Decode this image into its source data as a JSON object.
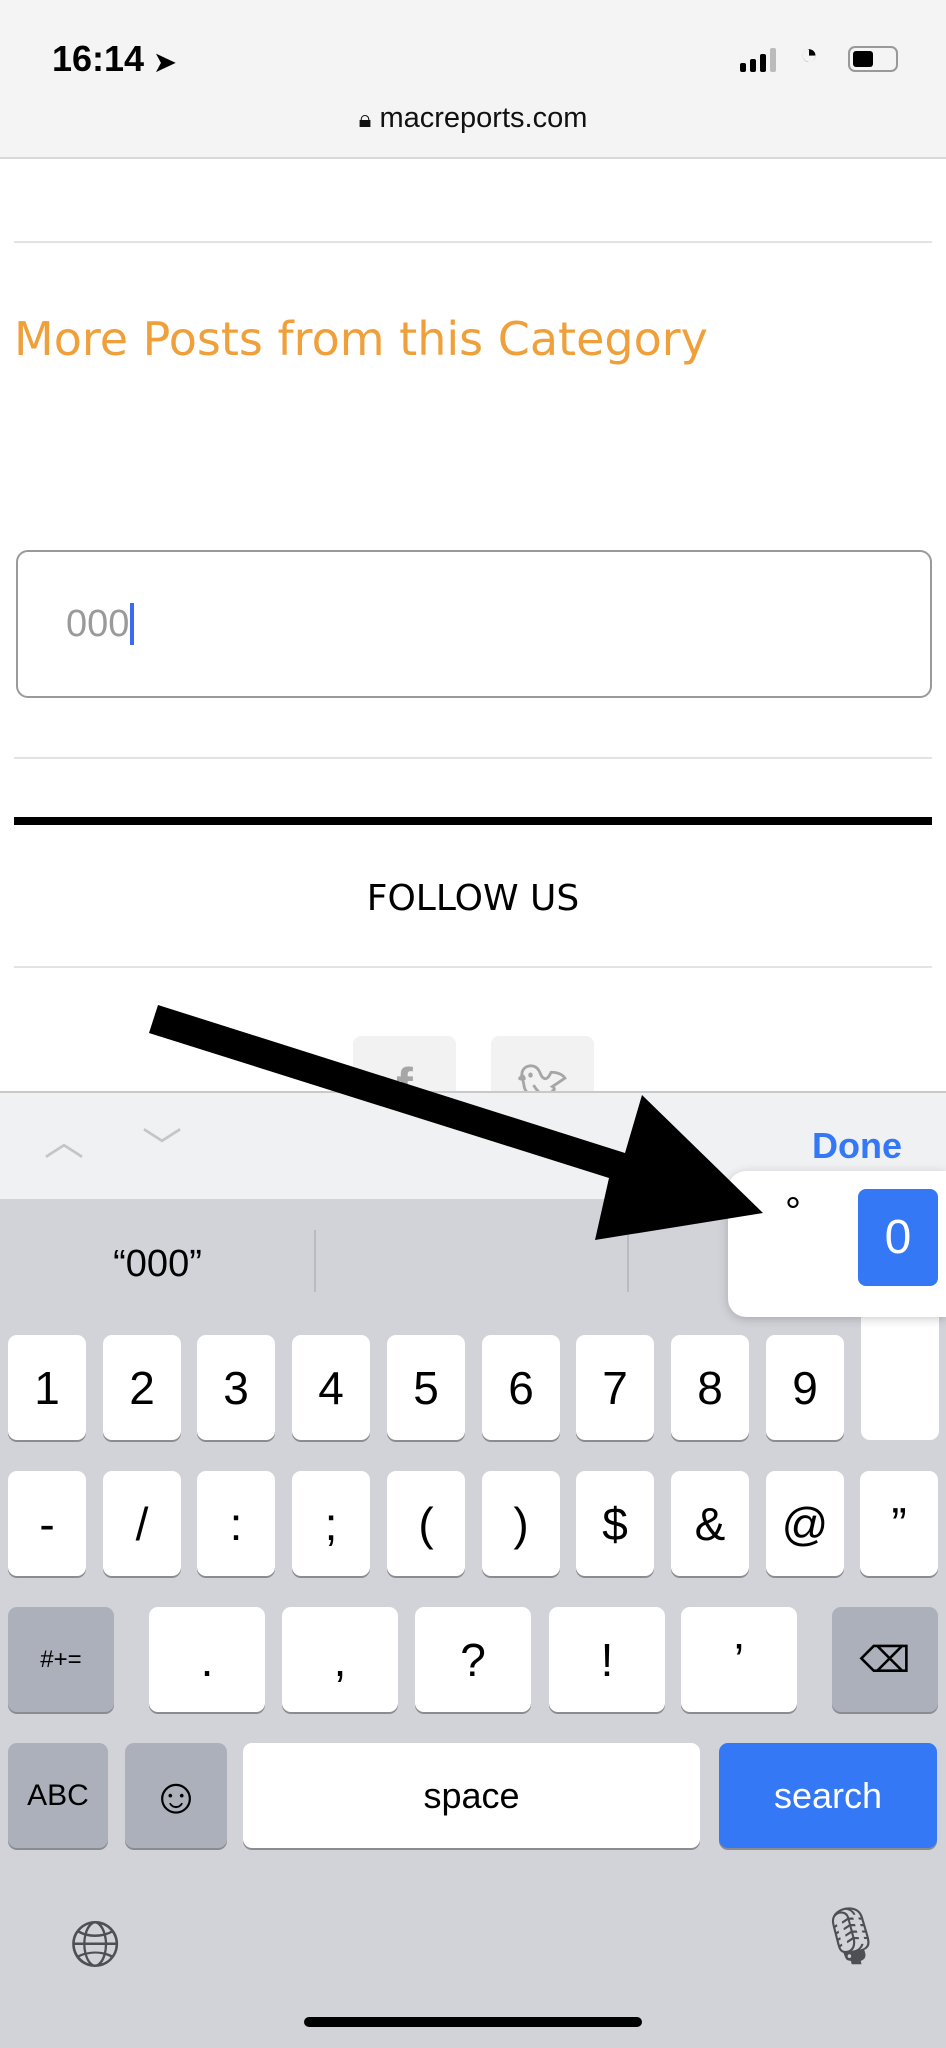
{
  "status": {
    "time": "16:14",
    "url": "macreports.com",
    "icons": [
      "location-arrow-icon",
      "signal-icon",
      "wifi-icon",
      "battery-icon",
      "lock-icon"
    ]
  },
  "page": {
    "heading": "More Posts from this Category",
    "input_value": "000",
    "follow": "FOLLOW US",
    "social": [
      "facebook",
      "twitter"
    ],
    "heading_color": "#f0a03a"
  },
  "accessory": {
    "done": "Done"
  },
  "keyboard": {
    "suggestion": "“000”",
    "popup": {
      "alt": "°",
      "selected": "0"
    },
    "row1": [
      "1",
      "2",
      "3",
      "4",
      "5",
      "6",
      "7",
      "8",
      "9",
      "0"
    ],
    "row2": [
      "-",
      "/",
      ":",
      ";",
      "(",
      ")",
      "$",
      "&",
      "@",
      "”"
    ],
    "row3": {
      "shift": "#+=",
      "keys": [
        ".",
        ",",
        "?",
        "!",
        "’"
      ]
    },
    "row4": {
      "abc": "ABC",
      "space": "space",
      "search": "search"
    },
    "accent": "#3478f6"
  }
}
